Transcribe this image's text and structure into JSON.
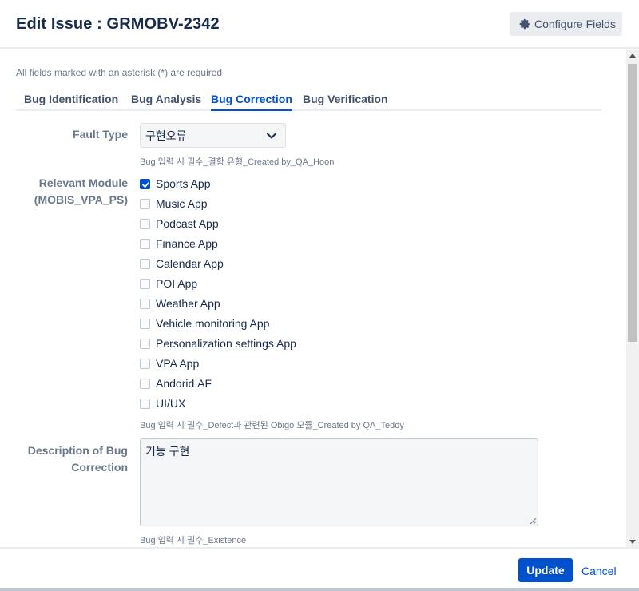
{
  "header": {
    "title": "Edit Issue : GRMOBV-2342",
    "configure_label": "Configure Fields"
  },
  "form": {
    "required_note": "All fields marked with an asterisk (*) are required",
    "tabs": [
      {
        "label": "Bug Identification",
        "active": false
      },
      {
        "label": "Bug Analysis",
        "active": false
      },
      {
        "label": "Bug Correction",
        "active": true
      },
      {
        "label": "Bug Verification",
        "active": false
      }
    ],
    "fault_type": {
      "label": "Fault Type",
      "value": "구현오류",
      "description": "Bug 입력 시 필수_결함 유형_Created by_QA_Hoon"
    },
    "relevant_module": {
      "label_line1": "Relevant Module",
      "label_line2": "(MOBIS_VPA_PS)",
      "options": [
        {
          "label": "Sports App",
          "checked": true
        },
        {
          "label": "Music App",
          "checked": false
        },
        {
          "label": "Podcast App",
          "checked": false
        },
        {
          "label": "Finance App",
          "checked": false
        },
        {
          "label": "Calendar App",
          "checked": false
        },
        {
          "label": "POI App",
          "checked": false
        },
        {
          "label": "Weather App",
          "checked": false
        },
        {
          "label": "Vehicle monitoring App",
          "checked": false
        },
        {
          "label": "Personalization settings App",
          "checked": false
        },
        {
          "label": "VPA App",
          "checked": false
        },
        {
          "label": "Andorid.AF",
          "checked": false
        },
        {
          "label": "UI/UX",
          "checked": false
        }
      ],
      "description": "Bug 입력 시 필수_Defect과 관련된 Obigo 모듈_Created by QA_Teddy"
    },
    "description_of_correction": {
      "label_line1": "Description of Bug",
      "label_line2": "Correction",
      "value": "기능 구현",
      "description": "Bug 입력 시 필수_Existence"
    }
  },
  "footer": {
    "update_label": "Update",
    "cancel_label": "Cancel"
  },
  "colors": {
    "primary": "#0052cc",
    "text": "#172b4d",
    "muted": "#6b778c"
  }
}
